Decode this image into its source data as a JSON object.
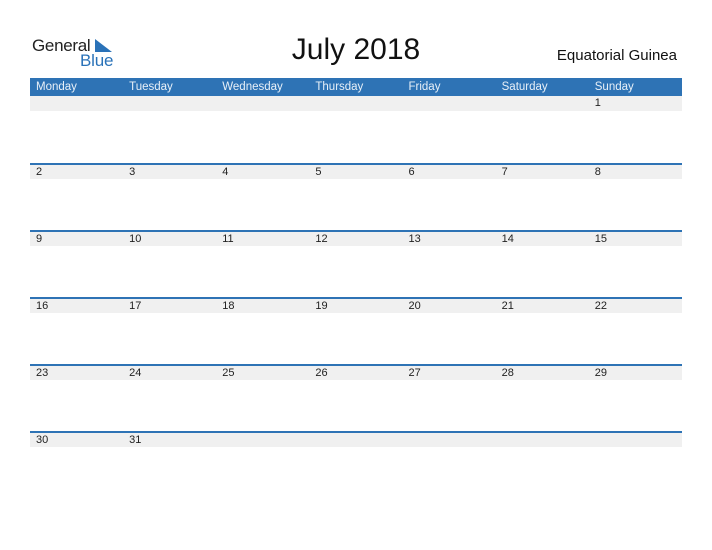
{
  "logo": {
    "line1": "General",
    "line2": "Blue"
  },
  "title": "July 2018",
  "country": "Equatorial Guinea",
  "colors": {
    "accent": "#2e73b5",
    "strip": "#f0f0f0"
  },
  "weekdays": [
    "Monday",
    "Tuesday",
    "Wednesday",
    "Thursday",
    "Friday",
    "Saturday",
    "Sunday"
  ],
  "weeks": [
    [
      "",
      "",
      "",
      "",
      "",
      "",
      "1"
    ],
    [
      "2",
      "3",
      "4",
      "5",
      "6",
      "7",
      "8"
    ],
    [
      "9",
      "10",
      "11",
      "12",
      "13",
      "14",
      "15"
    ],
    [
      "16",
      "17",
      "18",
      "19",
      "20",
      "21",
      "22"
    ],
    [
      "23",
      "24",
      "25",
      "26",
      "27",
      "28",
      "29"
    ],
    [
      "30",
      "31",
      "",
      "",
      "",
      "",
      ""
    ]
  ]
}
